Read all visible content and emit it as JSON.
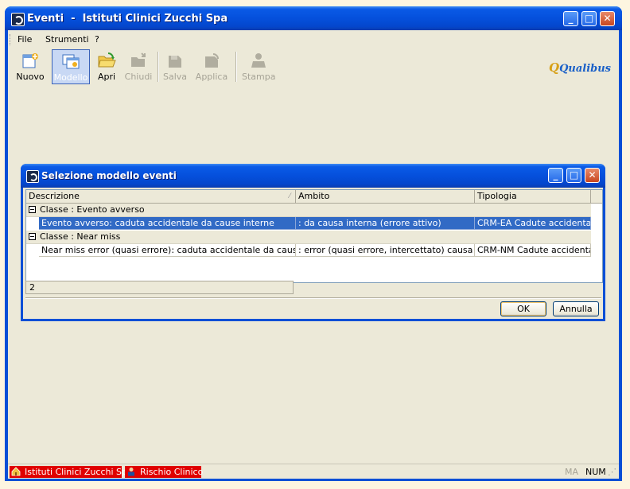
{
  "window": {
    "title": "Eventi  -  Istituti Clinici Zucchi Spa",
    "minimize_glyph": "_",
    "maximize_glyph": "□",
    "close_glyph": "✕"
  },
  "menu": [
    "File",
    "Strumenti",
    "?"
  ],
  "toolbar": {
    "buttons": [
      {
        "label": "Nuovo",
        "icon": "new-document-icon",
        "enabled": true
      },
      {
        "label": "Modello",
        "icon": "template-icon",
        "enabled": true,
        "active": true
      },
      {
        "label": "Apri",
        "icon": "open-folder-icon",
        "enabled": true
      },
      {
        "label": "Chiudi",
        "icon": "close-folder-icon",
        "enabled": false
      },
      {
        "label": "Salva",
        "icon": "save-icon",
        "enabled": false
      },
      {
        "label": "Applica",
        "icon": "apply-icon",
        "enabled": false
      },
      {
        "label": "Stampa",
        "icon": "print-icon",
        "enabled": false
      }
    ],
    "brand": "Qualibus"
  },
  "dialog": {
    "title": "Selezione modello eventi",
    "columns": [
      "Descrizione",
      "Ambito",
      "Tipologia"
    ],
    "groups": [
      {
        "label": "Classe : Evento avverso",
        "rows": [
          {
            "descrizione": "Evento avverso: caduta accidentale da cause interne",
            "ambito": ": da causa interna (errore attivo)",
            "tipologia": "CRM-EA Cadute accidentali",
            "selected": true
          }
        ]
      },
      {
        "label": "Classe : Near miss",
        "rows": [
          {
            "descrizione": "Near miss error (quasi errore): caduta accidentale da cause interne",
            "ambito": ": error (quasi errore, intercettato) causa interna",
            "tipologia": "CRM-NM Cadute accidentali",
            "selected": false
          }
        ]
      }
    ],
    "count": "2",
    "ok_label": "OK",
    "cancel_label": "Annulla"
  },
  "statusbar": {
    "company": "Istituti Clinici Zucchi Spa",
    "module": "Rischio Clinico",
    "ma": "MA",
    "num": "NUM"
  },
  "colors": {
    "titlebar": "#0550dc",
    "selection": "#316ac5",
    "status_red": "#e00000",
    "face": "#ece9d8"
  }
}
